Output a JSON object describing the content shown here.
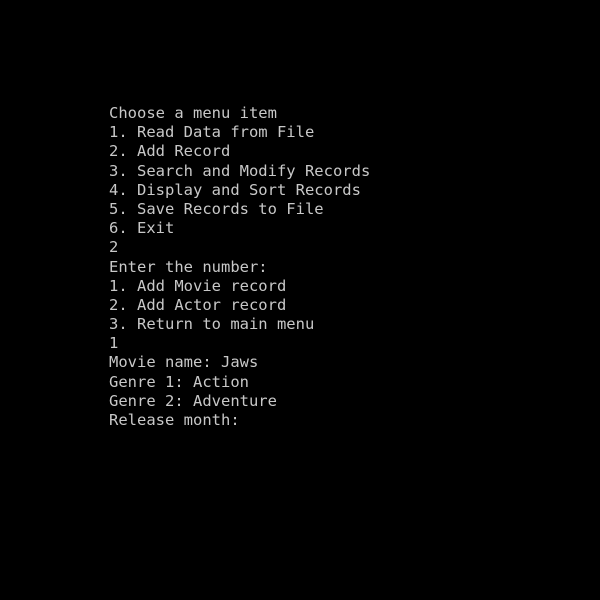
{
  "console": {
    "lines": [
      "Choose a menu item",
      "1. Read Data from File",
      "2. Add Record",
      "3. Search and Modify Records",
      "4. Display and Sort Records",
      "5. Save Records to File",
      "6. Exit",
      "2",
      "Enter the number:",
      "1. Add Movie record",
      "2. Add Actor record",
      "3. Return to main menu",
      "1",
      "Movie name: Jaws",
      "Genre 1: Action",
      "Genre 2: Adventure",
      "Release month:"
    ]
  },
  "colors": {
    "background": "#000000",
    "text": "#c8c8c8"
  }
}
